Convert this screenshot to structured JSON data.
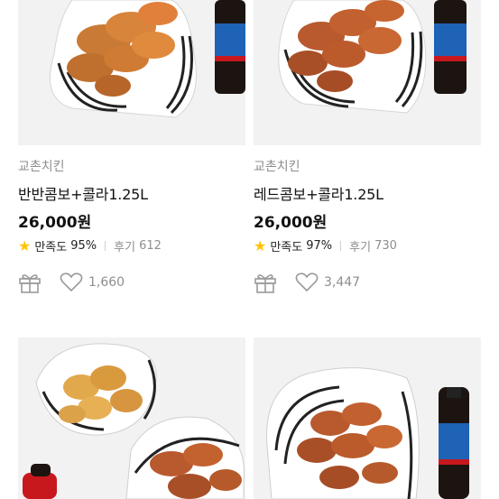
{
  "products": [
    {
      "brand": "교촌치킨",
      "name": "반반콤보+콜라1.25L",
      "price": "26,000원",
      "satisfaction_label": "만족도",
      "satisfaction_value": "95%",
      "review_label": "후기",
      "review_count": "612",
      "likes": "1,660",
      "icons": [
        "gift-icon",
        "heart-icon",
        "star-icon"
      ]
    },
    {
      "brand": "교촌치킨",
      "name": "레드콤보+콜라1.25L",
      "price": "26,000원",
      "satisfaction_label": "만족도",
      "satisfaction_value": "97%",
      "review_label": "후기",
      "review_count": "730",
      "likes": "3,447",
      "icons": [
        "gift-icon",
        "heart-icon",
        "star-icon"
      ]
    }
  ],
  "colors": {
    "star": "#ffc400",
    "muted_text": "#8e8e8e",
    "thumb_bg": "#f2f2f2",
    "fried_chicken": "#d9a04a",
    "red_chicken": "#b85a2e",
    "cola": "#1c1410",
    "cola_label": "#1e63b5"
  }
}
